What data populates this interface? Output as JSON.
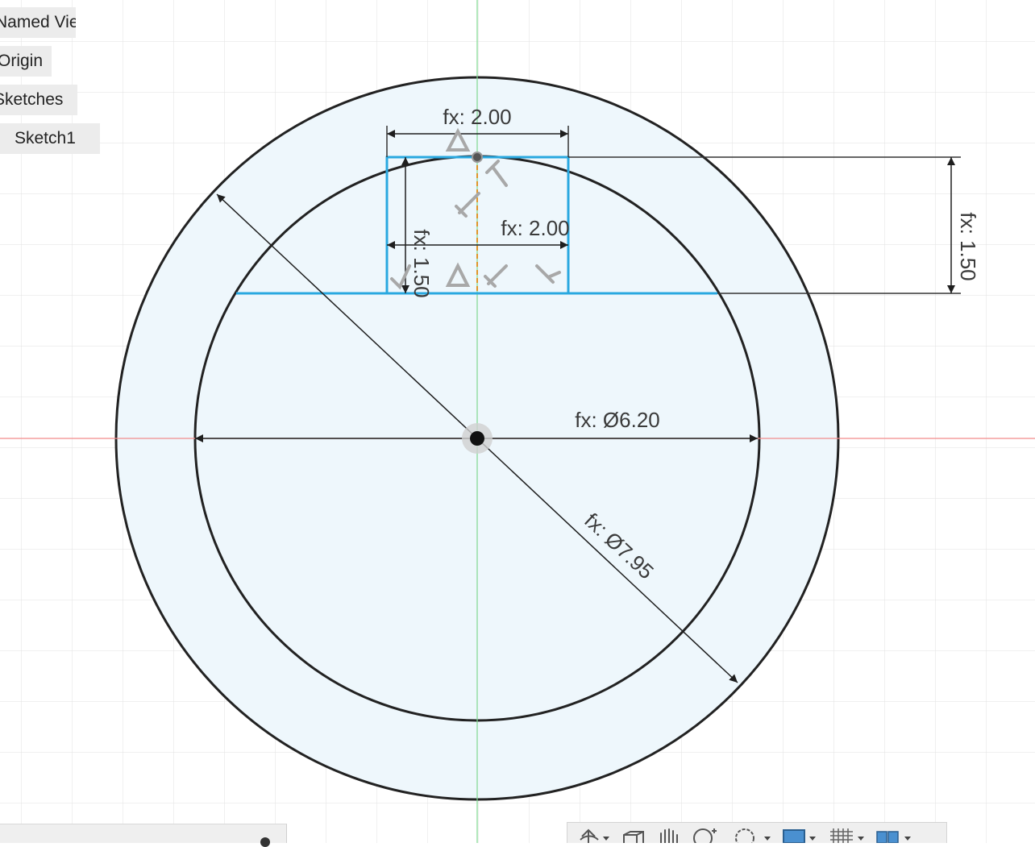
{
  "browser": {
    "items": [
      {
        "label": "Named Views"
      },
      {
        "label": "Origin"
      },
      {
        "label": "Sketches"
      },
      {
        "label": "Sketch1"
      }
    ]
  },
  "dimensions": {
    "top_width": "fx: 2.00",
    "inner_width": "fx: 2.00",
    "left_height": "fx: 1.50",
    "right_height": "fx: 1.50",
    "inner_diameter": "fx: Ø6.20",
    "outer_diameter": "fx: Ø7.95"
  },
  "colors": {
    "fill": "#eef7fc",
    "sketch_blue": "#29a8e0",
    "axis_red": "#f28b8b",
    "axis_green": "#7fd88f",
    "profile_black": "#222222",
    "constraint_orange": "#e0952a"
  },
  "toolbar": {
    "tools": [
      {
        "icon": "orbit-icon"
      },
      {
        "icon": "look-at-icon"
      },
      {
        "icon": "pan-hand-icon"
      },
      {
        "icon": "zoom-icon"
      },
      {
        "icon": "fit-window-icon"
      },
      {
        "icon": "display-settings-icon"
      },
      {
        "icon": "grid-settings-icon"
      },
      {
        "icon": "viewports-icon"
      }
    ]
  }
}
